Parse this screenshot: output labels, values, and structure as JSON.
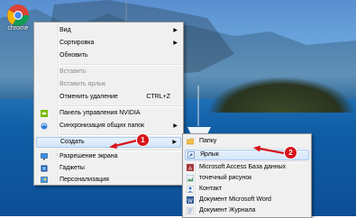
{
  "desktop": {
    "icons": [
      {
        "label": "chrome"
      }
    ]
  },
  "context_menu": {
    "items": [
      {
        "label": "Вид",
        "submenu": true
      },
      {
        "label": "Сортировка",
        "submenu": true
      },
      {
        "label": "Обновить"
      },
      {
        "label": "Вставить",
        "disabled": true
      },
      {
        "label": "Вставить ярлык",
        "disabled": true
      },
      {
        "label": "Отменить удаление",
        "shortcut": "CTRL+Z"
      },
      {
        "label": "Панель управления NVIDIA",
        "icon": "nvidia-icon"
      },
      {
        "label": "Синхронизация общих папок",
        "icon": "sync-icon",
        "submenu": true
      },
      {
        "label": "Создать",
        "submenu": true,
        "highlighted": true
      },
      {
        "label": "Разрешение экрана",
        "icon": "display-icon"
      },
      {
        "label": "Гаджеты",
        "icon": "gadgets-icon"
      },
      {
        "label": "Персонализация",
        "icon": "personalize-icon"
      }
    ]
  },
  "submenu_create": {
    "items": [
      {
        "label": "Папку",
        "icon": "folder-icon"
      },
      {
        "label": "Ярлык",
        "icon": "shortcut-icon",
        "highlighted": true
      },
      {
        "label": "Microsoft Access База данных",
        "icon": "access-icon"
      },
      {
        "label": "точечный рисунок",
        "icon": "bitmap-icon"
      },
      {
        "label": "Контакт",
        "icon": "contact-icon"
      },
      {
        "label": "Документ Microsoft Word",
        "icon": "word-icon"
      },
      {
        "label": "Документ Журнала",
        "icon": "journal-icon"
      }
    ]
  },
  "annotations": [
    {
      "number": "1"
    },
    {
      "number": "2"
    }
  ],
  "colors": {
    "badge": "#d7141a",
    "hover_border": "#a9cbf0"
  }
}
